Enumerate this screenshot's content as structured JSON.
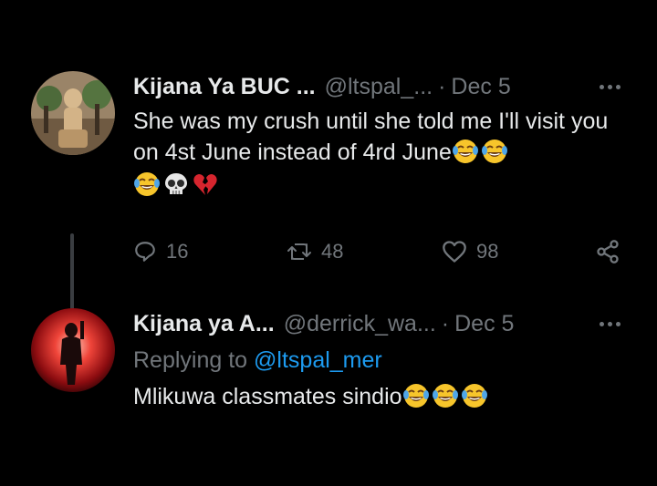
{
  "tweets": [
    {
      "name": "Kijana Ya BUC ...",
      "handle": "@ltspal_...",
      "dot": "·",
      "date": "Dec 5",
      "text": "She was my crush until she told me I'll visit you on 4st June instead of 4rd June",
      "emojis_inline": [
        "tears-of-joy-emoji",
        "tears-of-joy-emoji"
      ],
      "emojis_line": [
        "tears-of-joy-emoji",
        "skull-emoji",
        "broken-heart-emoji"
      ],
      "actions": {
        "replies": "16",
        "retweets": "48",
        "likes": "98"
      }
    },
    {
      "name": "Kijana ya A...",
      "handle": "@derrick_wa...",
      "dot": "·",
      "date": "Dec 5",
      "replying_prefix": "Replying to",
      "replying_to": "@ltspal_mer",
      "text": "Mlikuwa classmates sindio",
      "emojis_inline": [
        "tears-of-joy-emoji",
        "tears-of-joy-emoji",
        "tears-of-joy-emoji"
      ]
    }
  ],
  "colors": {
    "background": "#000000",
    "primary_text": "#e7e9ea",
    "secondary_text": "#71767b",
    "link": "#1d9bf0"
  }
}
